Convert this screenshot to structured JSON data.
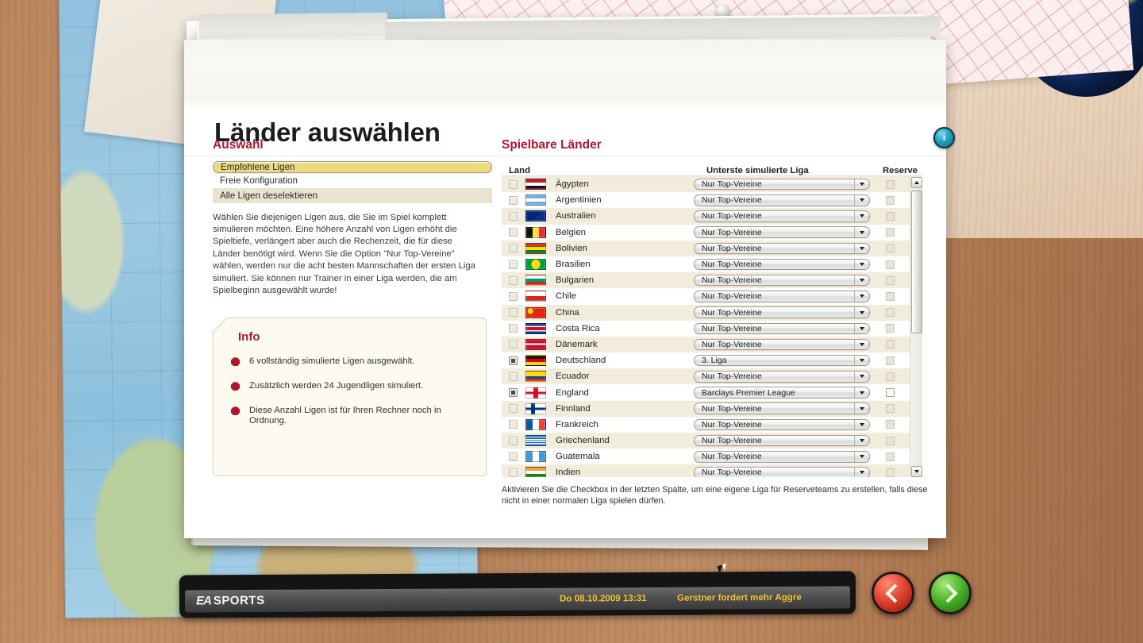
{
  "window": {
    "title": "Länder auswählen"
  },
  "left_panel": {
    "section_title": "Auswahl",
    "options": [
      {
        "label": "Empfohlene Ligen",
        "state": "selected"
      },
      {
        "label": "Freie Konfiguration",
        "state": "plain"
      },
      {
        "label": "Alle Ligen deselektieren",
        "state": "alt"
      }
    ],
    "description": "Wählen Sie diejenigen Ligen aus, die Sie im Spiel komplett simulieren möchten. Eine höhere Anzahl von Ligen erhöht die Spieltiefe, verlängert aber auch die Rechenzeit, die für diese Länder benötigt wird. Wenn Sie die Option \"Nur Top-Vereine\" wählen, werden nur die acht besten Mannschaften der ersten Liga simuliert. Sie können nur Trainer in einer Liga werden, die am Spielbeginn ausgewählt wurde!",
    "info": {
      "title": "Info",
      "items": [
        "6 vollständig simulierte Ligen ausgewählt.",
        "Zusätzlich werden 24 Jugendligen simuliert.",
        "Diese Anzahl Ligen ist für Ihren Rechner noch in Ordnung."
      ]
    }
  },
  "right_panel": {
    "section_title": "Spielbare Länder",
    "columns": {
      "land": "Land",
      "liga": "Unterste simulierte Liga",
      "reserve": "Reserve"
    },
    "note": "Aktivieren Sie die Checkbox in der letzten Spalte, um eine eigene Liga für Reserveteams zu erstellen, falls diese nicht in einer normalen Liga spielen dürfen.",
    "default_league": "Nur Top-Vereine",
    "rows": [
      {
        "country": "Ägypten",
        "checked": false,
        "league": "Nur Top-Vereine",
        "reserve_enabled": false,
        "flag": "eg"
      },
      {
        "country": "Argentinien",
        "checked": false,
        "league": "Nur Top-Vereine",
        "reserve_enabled": false,
        "flag": "ar"
      },
      {
        "country": "Australien",
        "checked": false,
        "league": "Nur Top-Vereine",
        "reserve_enabled": false,
        "flag": "au"
      },
      {
        "country": "Belgien",
        "checked": false,
        "league": "Nur Top-Vereine",
        "reserve_enabled": false,
        "flag": "be"
      },
      {
        "country": "Bolivien",
        "checked": false,
        "league": "Nur Top-Vereine",
        "reserve_enabled": false,
        "flag": "bo"
      },
      {
        "country": "Brasilien",
        "checked": false,
        "league": "Nur Top-Vereine",
        "reserve_enabled": false,
        "flag": "br"
      },
      {
        "country": "Bulgarien",
        "checked": false,
        "league": "Nur Top-Vereine",
        "reserve_enabled": false,
        "flag": "bg"
      },
      {
        "country": "Chile",
        "checked": false,
        "league": "Nur Top-Vereine",
        "reserve_enabled": false,
        "flag": "cl"
      },
      {
        "country": "China",
        "checked": false,
        "league": "Nur Top-Vereine",
        "reserve_enabled": false,
        "flag": "cn"
      },
      {
        "country": "Costa Rica",
        "checked": false,
        "league": "Nur Top-Vereine",
        "reserve_enabled": false,
        "flag": "cr"
      },
      {
        "country": "Dänemark",
        "checked": false,
        "league": "Nur Top-Vereine",
        "reserve_enabled": false,
        "flag": "dk"
      },
      {
        "country": "Deutschland",
        "checked": true,
        "league": "3. Liga",
        "reserve_enabled": false,
        "flag": "de"
      },
      {
        "country": "Ecuador",
        "checked": false,
        "league": "Nur Top-Vereine",
        "reserve_enabled": false,
        "flag": "ec"
      },
      {
        "country": "England",
        "checked": true,
        "league": "Barclays Premier League",
        "reserve_enabled": true,
        "flag": "en"
      },
      {
        "country": "Finnland",
        "checked": false,
        "league": "Nur Top-Vereine",
        "reserve_enabled": false,
        "flag": "fi"
      },
      {
        "country": "Frankreich",
        "checked": false,
        "league": "Nur Top-Vereine",
        "reserve_enabled": false,
        "flag": "fr"
      },
      {
        "country": "Griechenland",
        "checked": false,
        "league": "Nur Top-Vereine",
        "reserve_enabled": false,
        "flag": "gr"
      },
      {
        "country": "Guatemala",
        "checked": false,
        "league": "Nur Top-Vereine",
        "reserve_enabled": false,
        "flag": "gt"
      },
      {
        "country": "Indien",
        "checked": false,
        "league": "Nur Top-Vereine",
        "reserve_enabled": false,
        "flag": "in"
      }
    ]
  },
  "info_button": {
    "glyph": "i"
  },
  "bottom_bar": {
    "brand_mark": "EA",
    "brand_text": "SPORTS",
    "datetime": "Do 08.10.2009 13:31",
    "news": "Gerstner fordert mehr Aggre"
  },
  "nav": {
    "prev_label": "‹",
    "next_label": "›"
  },
  "colors": {
    "accent_red": "#a8192e",
    "highlight_yellow": "#edda7d",
    "row_alt": "#f1ecdc",
    "ticker_yellow": "#f2c233"
  }
}
